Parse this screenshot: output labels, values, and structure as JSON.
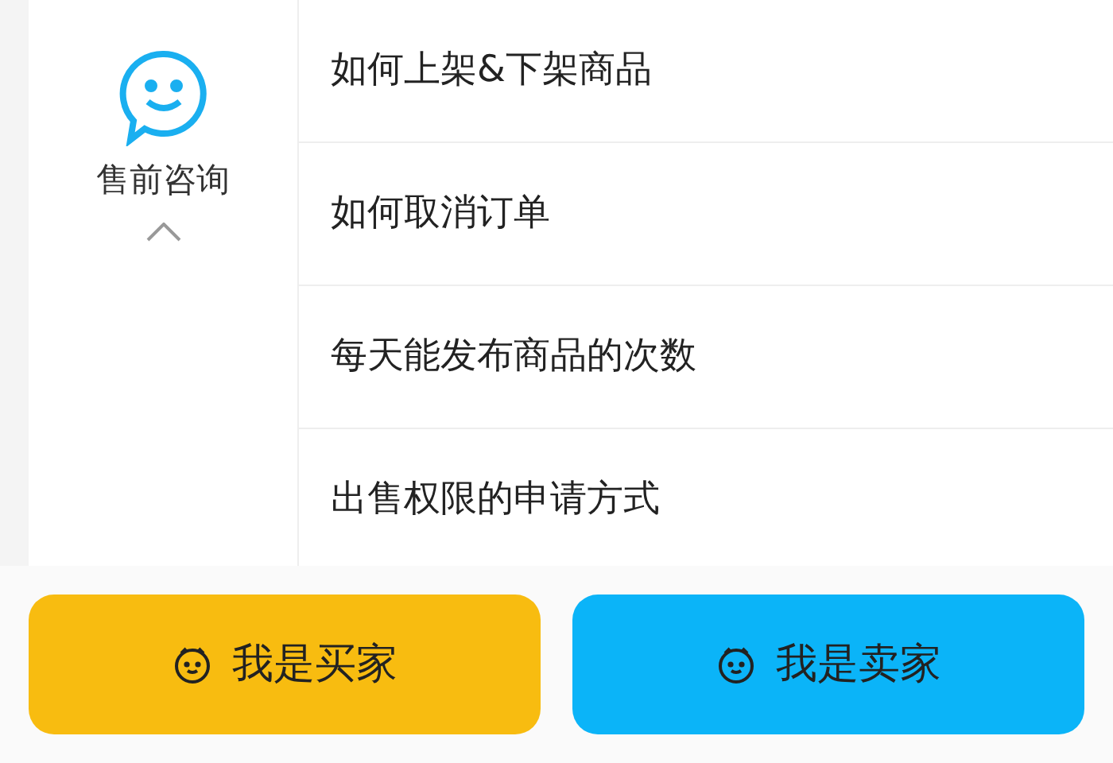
{
  "category": {
    "label": "售前咨询",
    "expanded": true
  },
  "questions": [
    "如何上架&下架商品",
    "如何取消订单",
    "每天能发布商品的次数",
    "出售权限的申请方式"
  ],
  "buttons": [
    {
      "label": "我是买家",
      "kind": "buyer"
    },
    {
      "label": "我是卖家",
      "kind": "seller"
    }
  ]
}
